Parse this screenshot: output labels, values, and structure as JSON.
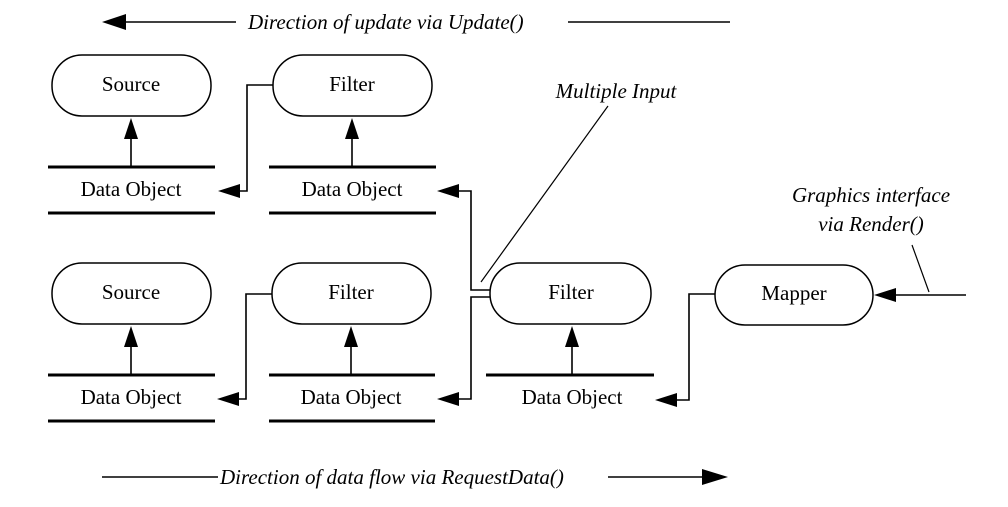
{
  "diagram": {
    "top_arrow_label": "Direction of update via Update()",
    "bottom_arrow_label": "Direction of data flow via RequestData()",
    "multiple_input_label": "Multiple Input",
    "graphics_label_line1": "Graphics interface",
    "graphics_label_line2": "via Render()",
    "processes": {
      "source_top": "Source",
      "filter_top": "Filter",
      "source_bottom": "Source",
      "filter_bottom": "Filter",
      "filter_multi": "Filter",
      "mapper": "Mapper"
    },
    "data_objects": {
      "source_top": "Data Object",
      "filter_top": "Data Object",
      "source_bottom": "Data Object",
      "filter_bottom": "Data Object",
      "filter_multi": "Data Object"
    }
  }
}
